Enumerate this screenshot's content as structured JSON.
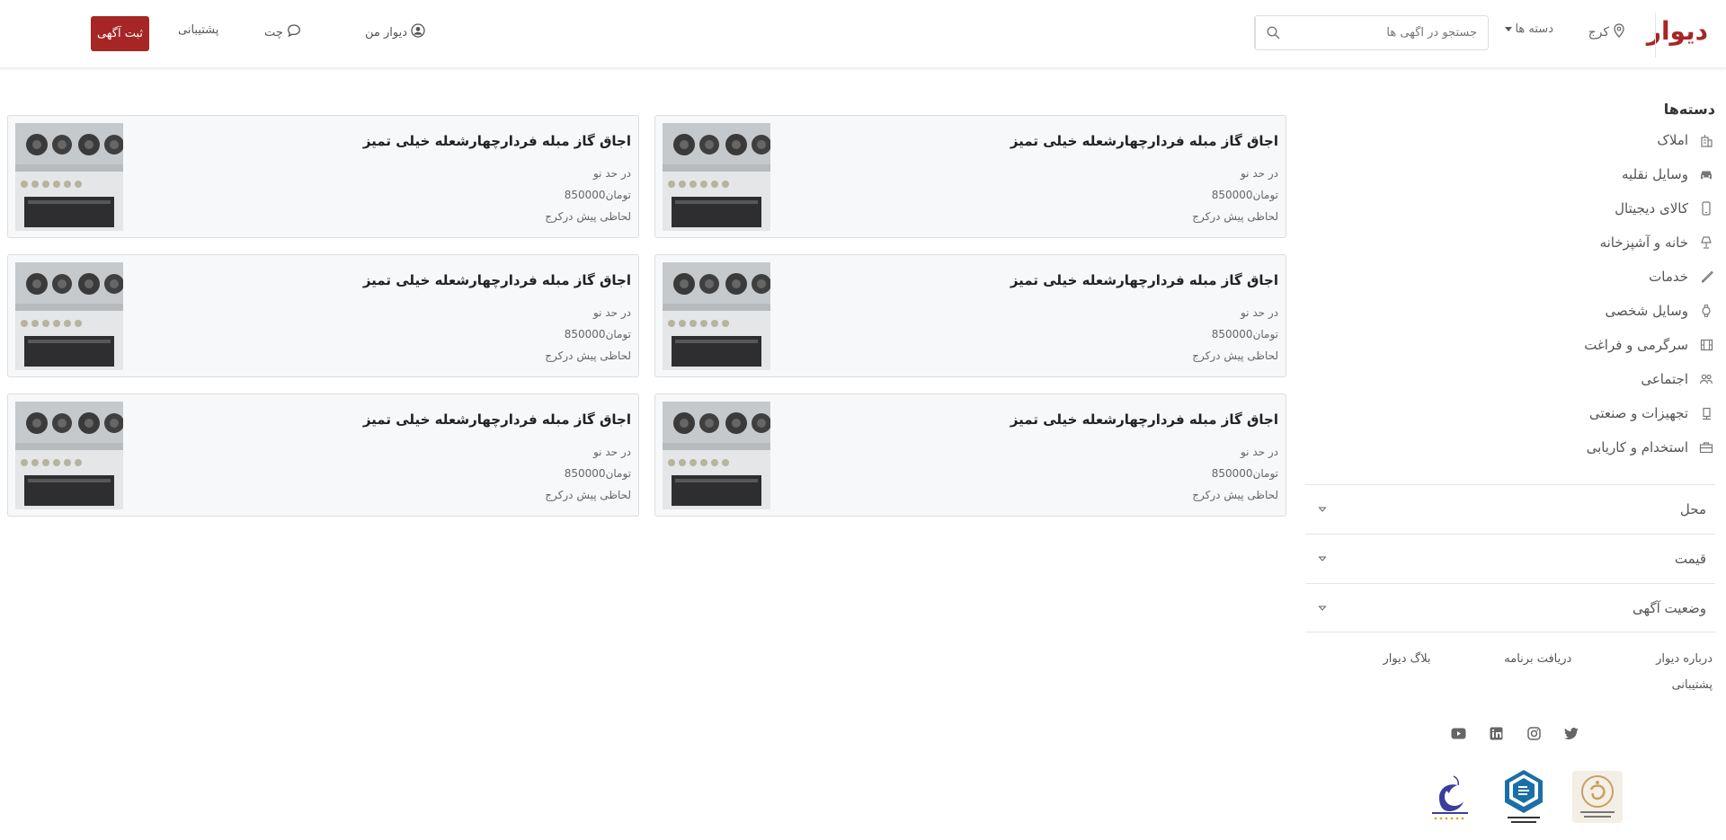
{
  "header": {
    "logo": "دیوار",
    "city": "کرج",
    "categories_label": "دسته ها",
    "search_placeholder": "جستجو در آگهی ها",
    "my_divar": "دیوار من",
    "chat": "چت",
    "support": "پشتیبانی",
    "post_ad": "ثبت آگهی",
    "accent_color": "#a62626"
  },
  "sidebar": {
    "title": "دسته‌ها",
    "categories": [
      {
        "label": "املاک",
        "icon": "building-icon"
      },
      {
        "label": "وسایل نقلیه",
        "icon": "car-icon"
      },
      {
        "label": "کالای دیجیتال",
        "icon": "phone-icon"
      },
      {
        "label": "خانه و آشپزخانه",
        "icon": "lamp-icon"
      },
      {
        "label": "خدمات",
        "icon": "brush-icon"
      },
      {
        "label": "وسایل شخصی",
        "icon": "watch-icon"
      },
      {
        "label": "سرگرمی و فراغت",
        "icon": "film-icon"
      },
      {
        "label": "اجتماعی",
        "icon": "people-icon"
      },
      {
        "label": "تجهیزات و صنعتی",
        "icon": "industry-icon"
      },
      {
        "label": "استخدام و کاریابی",
        "icon": "briefcase-icon"
      }
    ],
    "filters": [
      "محل",
      "قیمت",
      "وضعیت آگهی"
    ]
  },
  "footer": {
    "links": [
      "درباره دیوار",
      "دریافت برنامه",
      "بلاگ دیوار",
      "پشتیبانی"
    ],
    "social": [
      "twitter-icon",
      "instagram-icon",
      "linkedin-icon",
      "youtube-icon"
    ],
    "badges": [
      "samandehi-badge",
      "nezam-senfi-badge",
      "enamad-badge"
    ]
  },
  "listings": [
    {
      "title": "اجاق گاز مبله فردارچهارشعله خیلی تمیز",
      "condition": "در حد نو",
      "price": "850000",
      "currency": "تومان",
      "time": "لحاظی پیش درکرج"
    },
    {
      "title": "اجاق گاز مبله فردارچهارشعله خیلی تمیز",
      "condition": "در حد نو",
      "price": "850000",
      "currency": "تومان",
      "time": "لحاظی پیش درکرج"
    },
    {
      "title": "اجاق گاز مبله فردارچهارشعله خیلی تمیز",
      "condition": "در حد نو",
      "price": "850000",
      "currency": "تومان",
      "time": "لحاظی پیش درکرج"
    },
    {
      "title": "اجاق گاز مبله فردارچهارشعله خیلی تمیز",
      "condition": "در حد نو",
      "price": "850000",
      "currency": "تومان",
      "time": "لحاظی پیش درکرج"
    },
    {
      "title": "اجاق گاز مبله فردارچهارشعله خیلی تمیز",
      "condition": "در حد نو",
      "price": "850000",
      "currency": "تومان",
      "time": "لحاظی پیش درکرج"
    },
    {
      "title": "اجاق گاز مبله فردارچهارشعله خیلی تمیز",
      "condition": "در حد نو",
      "price": "850000",
      "currency": "تومان",
      "time": "لحاظی پیش درکرج"
    }
  ]
}
